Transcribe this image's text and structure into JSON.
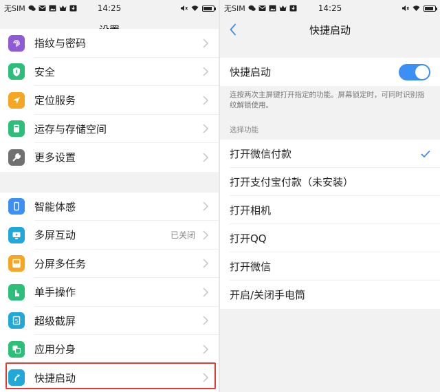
{
  "status_left": {
    "carrier_left": "无SIM",
    "time_left": "14:25",
    "carrier_right": "无SIM",
    "time_right": "14:25"
  },
  "settings": {
    "title": "设置",
    "items_group1": [
      {
        "label": "指纹与密码",
        "icon": "fingerprint-icon",
        "color": "#8e5ad6"
      },
      {
        "label": "安全",
        "icon": "shield-icon",
        "color": "#2bbf7a"
      },
      {
        "label": "定位服务",
        "icon": "location-icon",
        "color": "#f5a623"
      },
      {
        "label": "运存与存储空间",
        "icon": "storage-icon",
        "color": "#2bbf7a"
      },
      {
        "label": "更多设置",
        "icon": "wrench-icon",
        "color": "#707070"
      }
    ],
    "items_group2": [
      {
        "label": "智能体感",
        "icon": "phone-motion-icon",
        "color": "#3b8ff5",
        "value": ""
      },
      {
        "label": "多屏互动",
        "icon": "multiscreen-icon",
        "color": "#1fa8d8",
        "value": "已关闭"
      },
      {
        "label": "分屏多任务",
        "icon": "split-screen-icon",
        "color": "#f5a623",
        "value": ""
      },
      {
        "label": "单手操作",
        "icon": "one-hand-icon",
        "color": "#2bbf7a",
        "value": ""
      },
      {
        "label": "超级截屏",
        "icon": "screenshot-icon",
        "color": "#1fa8d8",
        "value": ""
      },
      {
        "label": "应用分身",
        "icon": "app-clone-icon",
        "color": "#2bbf7a",
        "value": ""
      },
      {
        "label": "快捷启动",
        "icon": "quick-launch-icon",
        "color": "#1fa8d8",
        "value": ""
      }
    ]
  },
  "quick_launch": {
    "title": "快捷启动",
    "toggle_label": "快捷启动",
    "toggle_on": true,
    "description": "连按两次主屏键打开指定的功能。屏幕锁定时，可同时识别指纹解锁使用。",
    "section_title": "选择功能",
    "options": [
      {
        "label": "打开微信付款",
        "selected": true
      },
      {
        "label": "打开支付宝付款（未安装）",
        "selected": false
      },
      {
        "label": "打开相机",
        "selected": false
      },
      {
        "label": "打开QQ",
        "selected": false
      },
      {
        "label": "打开微信",
        "selected": false
      },
      {
        "label": "开启/关闭手电筒",
        "selected": false
      }
    ],
    "accent_color": "#3b8ff5"
  }
}
